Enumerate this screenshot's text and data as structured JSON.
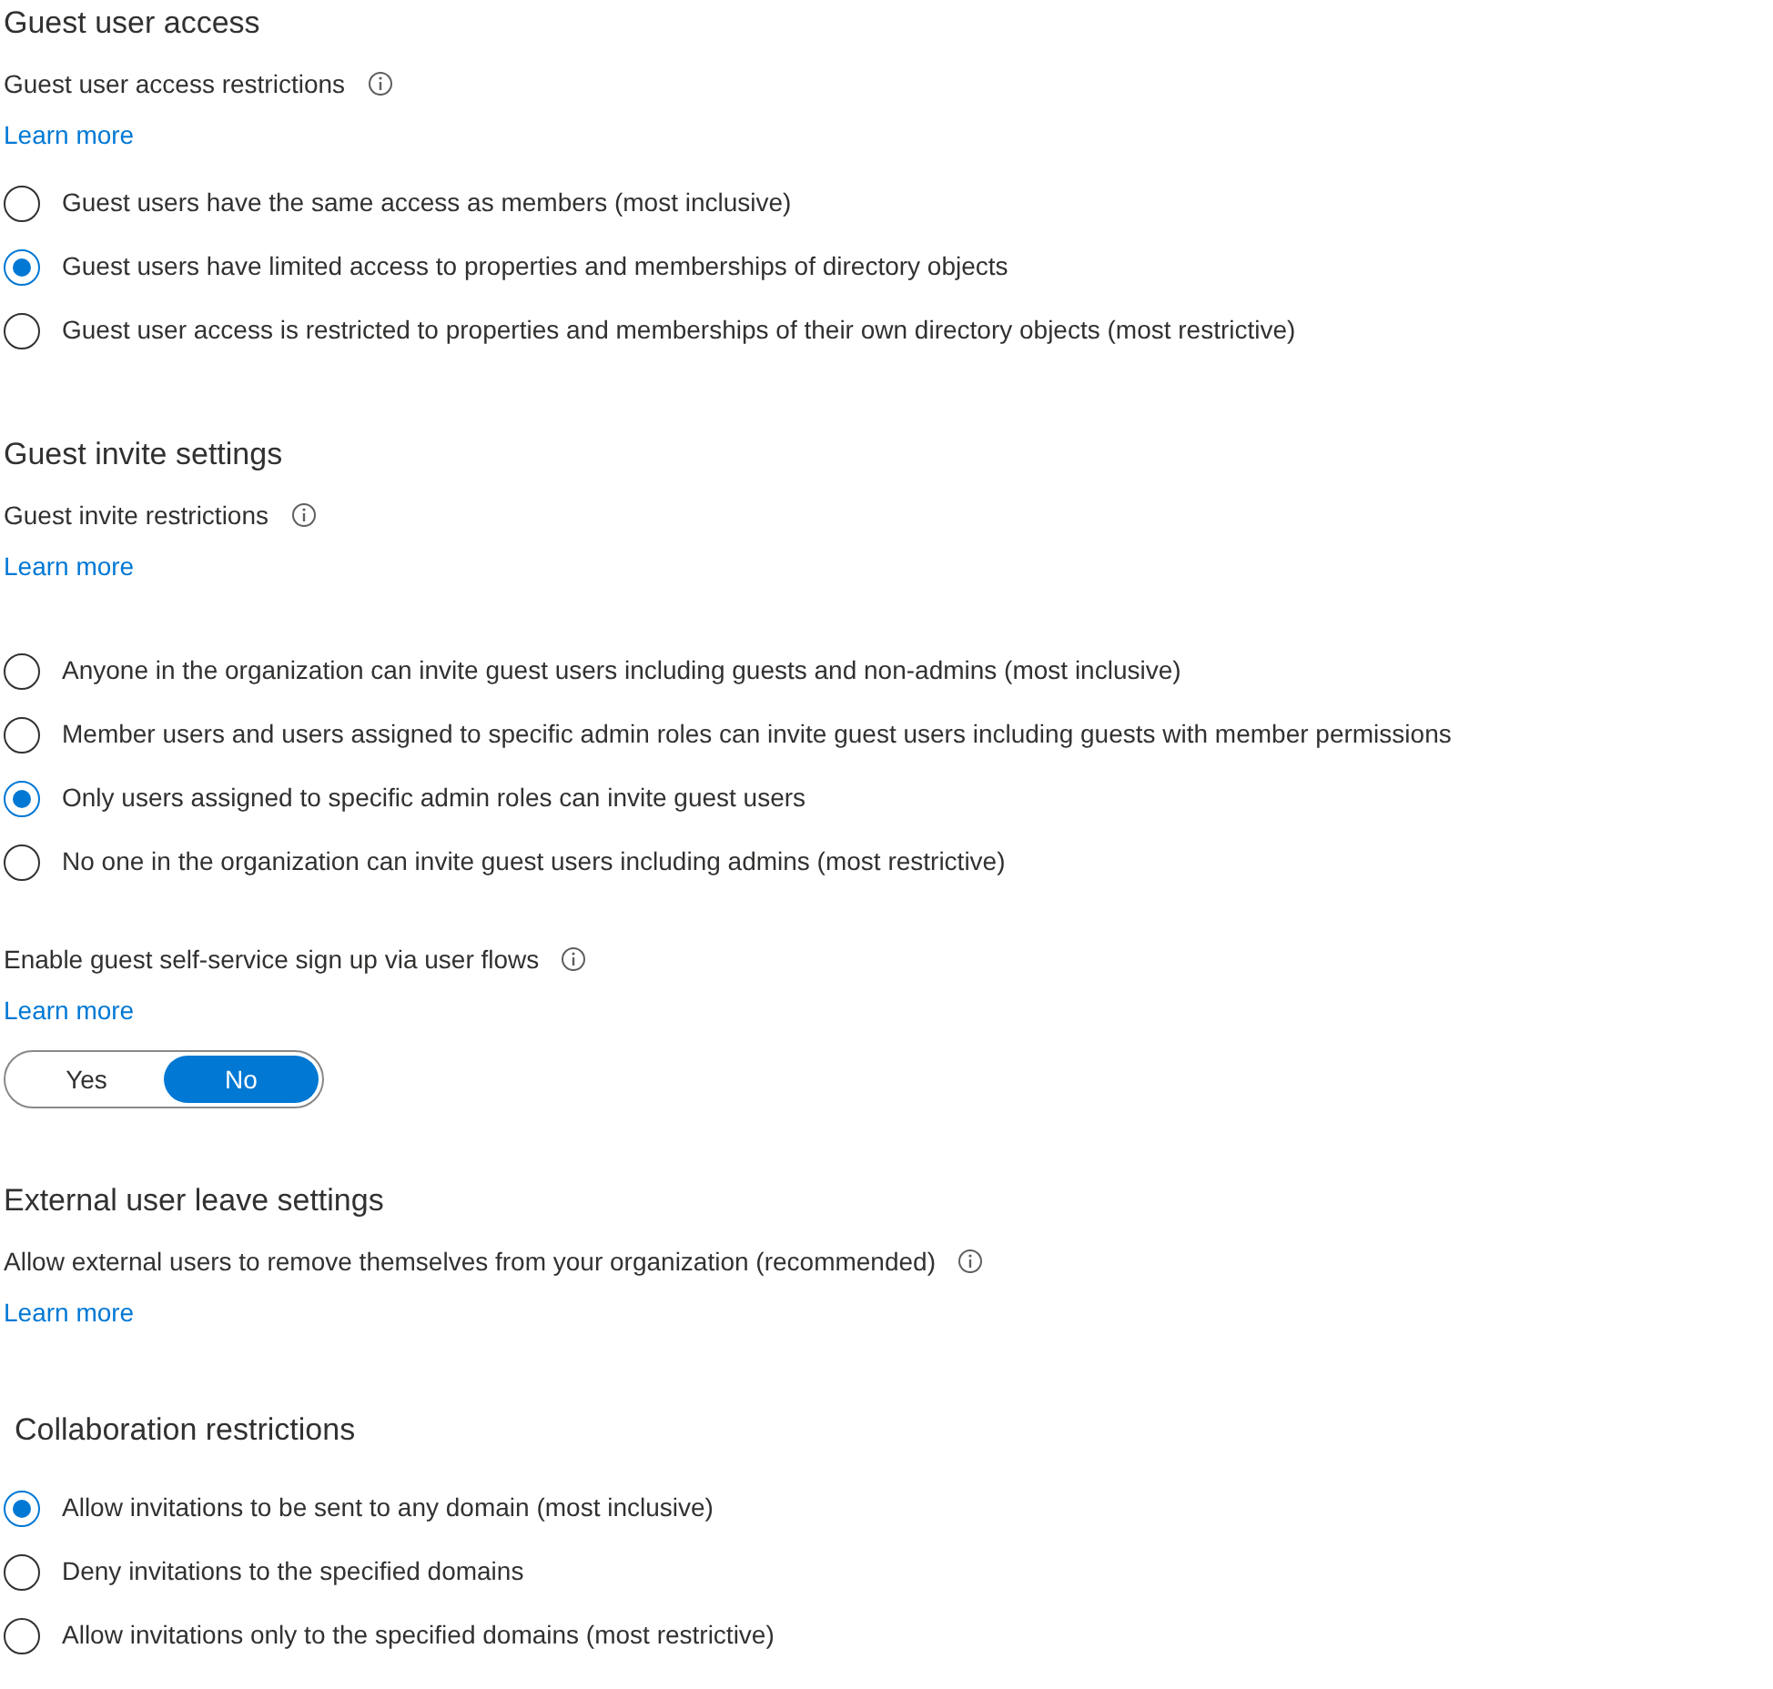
{
  "sections": [
    {
      "title": "Guest user access",
      "settings": [
        {
          "kind": "radio",
          "label": "Guest user access restrictions",
          "learn_more": "Learn more",
          "options": [
            {
              "label": "Guest users have the same access as members (most inclusive)",
              "selected": false
            },
            {
              "label": "Guest users have limited access to properties and memberships of directory objects",
              "selected": true
            },
            {
              "label": "Guest user access is restricted to properties and memberships of their own directory objects (most restrictive)",
              "selected": false
            }
          ]
        }
      ]
    },
    {
      "title": "Guest invite settings",
      "settings": [
        {
          "kind": "radio",
          "label": "Guest invite restrictions",
          "learn_more": "Learn more",
          "options": [
            {
              "label": "Anyone in the organization can invite guest users including guests and non-admins (most inclusive)",
              "selected": false
            },
            {
              "label": "Member users and users assigned to specific admin roles can invite guest users including guests with member permissions",
              "selected": false
            },
            {
              "label": "Only users assigned to specific admin roles can invite guest users",
              "selected": true
            },
            {
              "label": "No one in the organization can invite guest users including admins (most restrictive)",
              "selected": false
            }
          ]
        },
        {
          "kind": "toggle",
          "label": "Enable guest self-service sign up via user flows",
          "learn_more": "Learn more",
          "options": [
            {
              "label": "Yes",
              "selected": false
            },
            {
              "label": "No",
              "selected": true
            }
          ]
        }
      ]
    },
    {
      "title": "External user leave settings",
      "settings": [
        {
          "kind": "text",
          "label": "Allow external users to remove themselves from your organization (recommended)",
          "learn_more": "Learn more"
        }
      ]
    },
    {
      "title": "Collaboration restrictions",
      "settings": [
        {
          "kind": "radio",
          "options": [
            {
              "label": "Allow invitations to be sent to any domain (most inclusive)",
              "selected": true
            },
            {
              "label": "Deny invitations to the specified domains",
              "selected": false
            },
            {
              "label": "Allow invitations only to the specified domains (most restrictive)",
              "selected": false
            }
          ]
        }
      ]
    }
  ]
}
